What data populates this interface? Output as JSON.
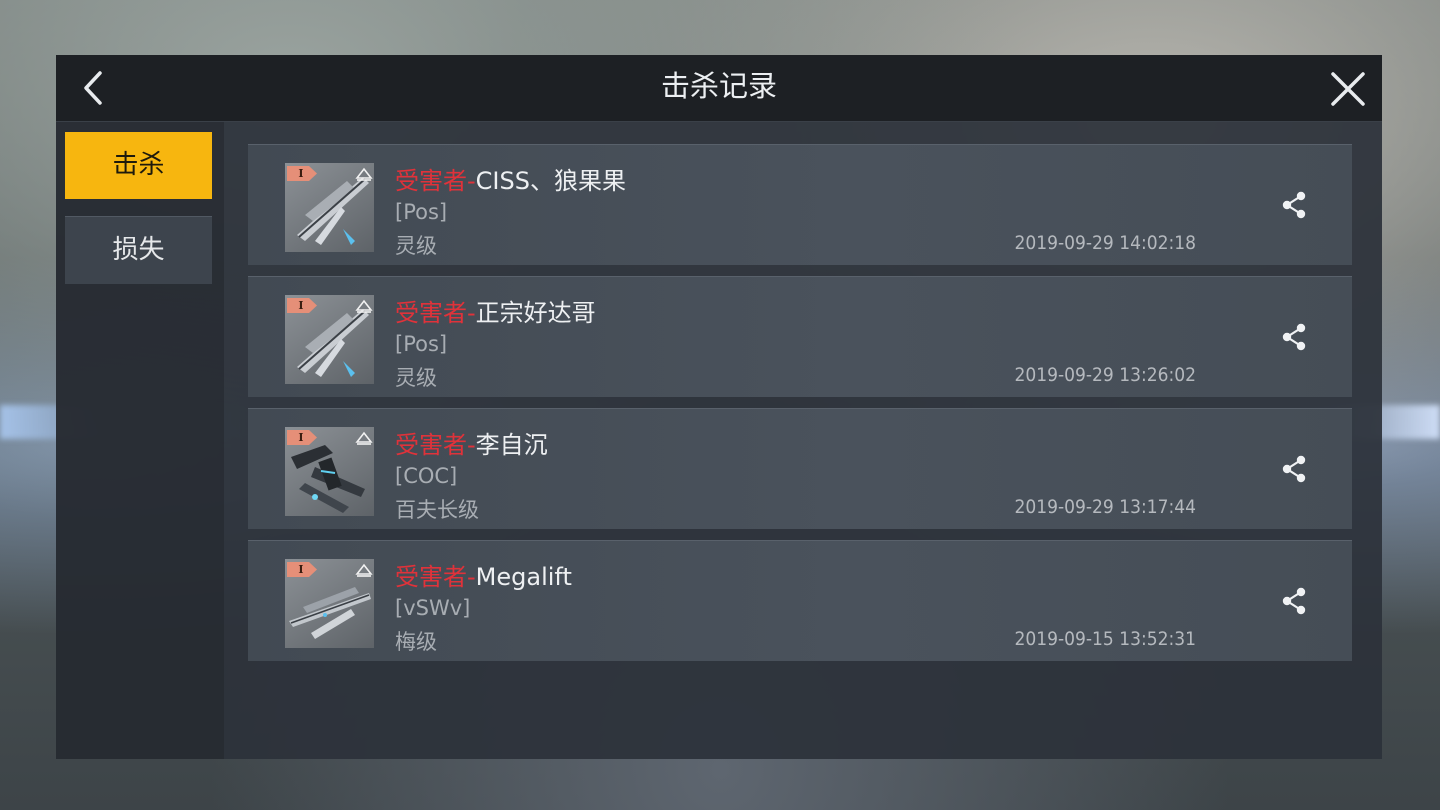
{
  "header": {
    "title": "击杀记录"
  },
  "tabs": [
    {
      "label": "击杀"
    },
    {
      "label": "损失"
    }
  ],
  "records": [
    {
      "victim_label": "受害者-",
      "victim": "CISS、狼果果",
      "corp": "[Pos]",
      "ship_class": "灵级",
      "time": "2019-09-29 14:02:18",
      "tier": "I"
    },
    {
      "victim_label": "受害者-",
      "victim": "正宗好达哥",
      "corp": "[Pos]",
      "ship_class": "灵级",
      "time": "2019-09-29 13:26:02",
      "tier": "I"
    },
    {
      "victim_label": "受害者-",
      "victim": "李自沉",
      "corp": "[COC]",
      "ship_class": "百夫长级",
      "time": "2019-09-29 13:17:44",
      "tier": "I"
    },
    {
      "victim_label": "受害者-",
      "victim": "Megalift",
      "corp": "[vSWv]",
      "ship_class": "梅级",
      "time": "2019-09-15 13:52:31",
      "tier": "I"
    }
  ],
  "colors": {
    "accent": "#f7b60f",
    "victim_label": "#e0323a"
  }
}
